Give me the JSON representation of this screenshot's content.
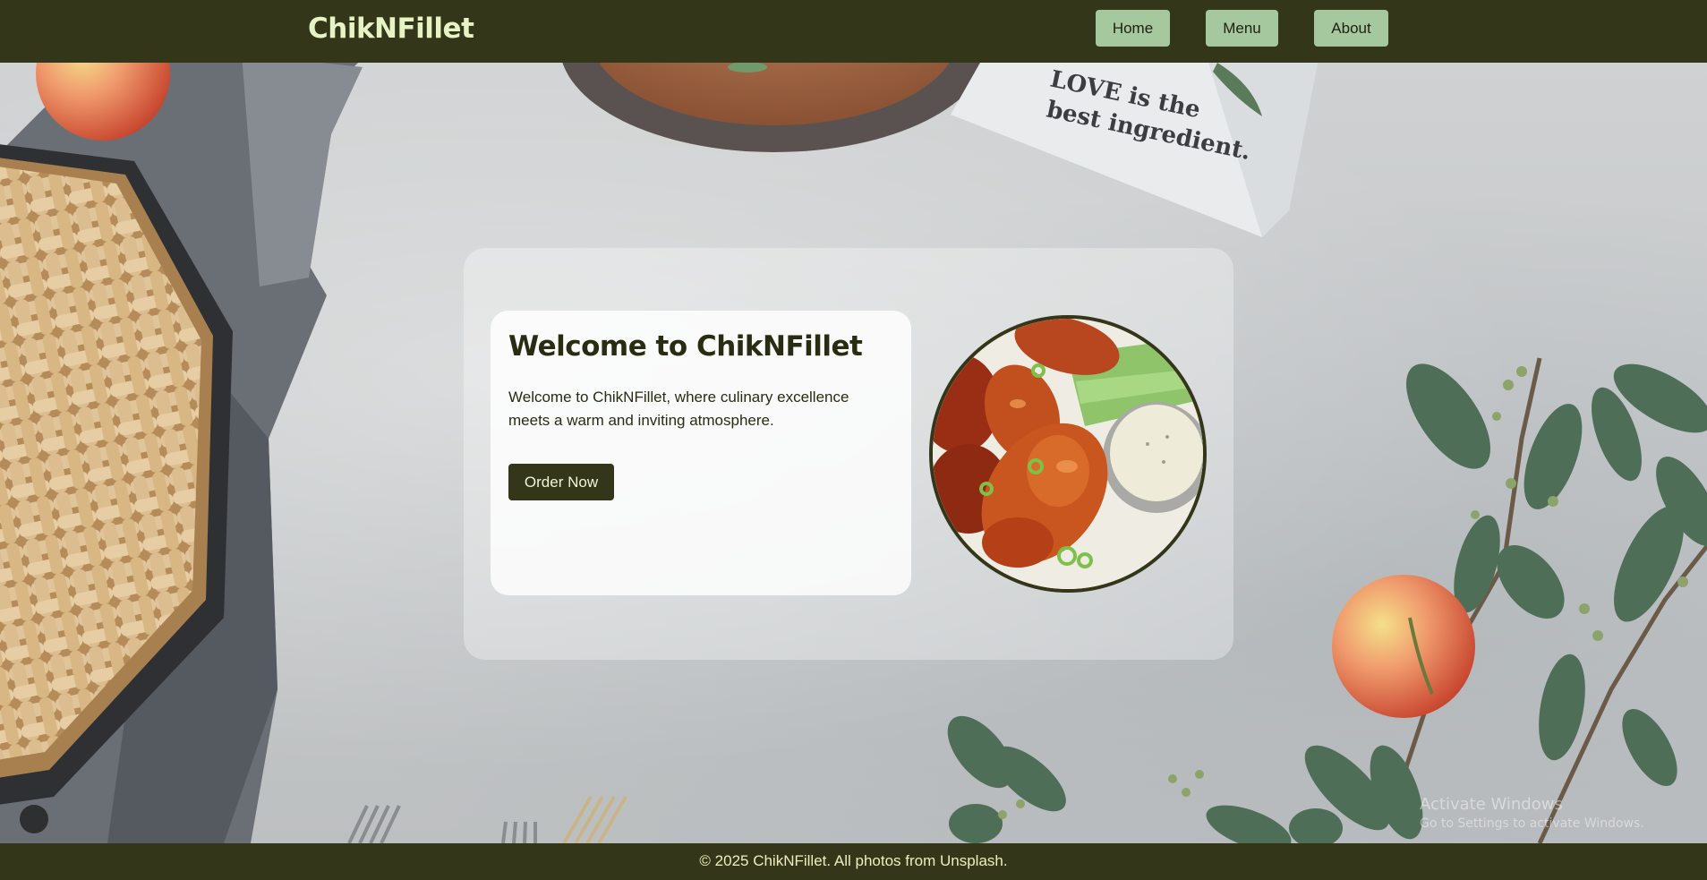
{
  "header": {
    "brand": "ChikNFillet",
    "nav": [
      {
        "label": "Home"
      },
      {
        "label": "Menu"
      },
      {
        "label": "About"
      }
    ]
  },
  "hero": {
    "title": "Welcome to ChikNFillet",
    "description": "Welcome to ChikNFillet, where culinary excellence meets a warm and inviting atmosphere.",
    "cta_label": "Order Now"
  },
  "background": {
    "towel_text_line1": "LOVE is the",
    "towel_text_line2": "best ingredient."
  },
  "footer": {
    "text": "© 2025 ChikNFillet. All photos from Unsplash."
  },
  "os_overlay": {
    "line1": "Activate Windows",
    "line2": "Go to Settings to activate Windows."
  },
  "colors": {
    "header_bg": "#333618",
    "brand_text": "#e7f3c4",
    "nav_button_bg": "#a6c89f",
    "cta_bg": "#333618",
    "footer_text": "#f0ecc0"
  }
}
